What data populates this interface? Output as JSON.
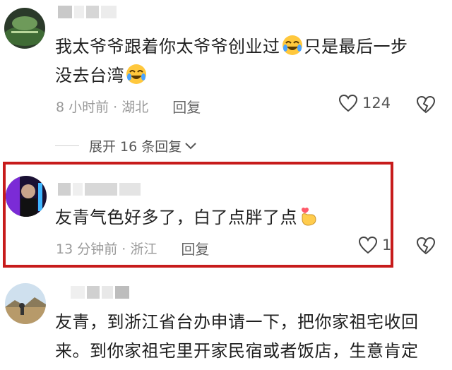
{
  "comments": [
    {
      "text_line1": "我太爷爷跟着你太爷爷创业过",
      "text_line1_after": "只是最后一步",
      "text_line2": "没去台湾",
      "time": "8 小时前 · 湖北",
      "reply_label": "回复",
      "likes": "124"
    },
    {
      "text": "友青气色好多了，白了点胖了点",
      "time": "13 分钟前 · 浙江",
      "reply_label": "回复",
      "likes": "1"
    },
    {
      "text_line1": "友青，到浙江省台办申请一下，把你家祖宅收回",
      "text_line2": "来。到你家祖宅里开家民宿或者饭店，生意肯定"
    }
  ],
  "expand_replies": "展开 16 条回复",
  "colors": {
    "highlight": "#c71b1b",
    "meta": "#9a9a9a"
  },
  "icons": [
    "laughing-emoji-icon",
    "heart-icon",
    "broken-heart-icon",
    "chevron-down-icon",
    "hand-heart-emoji-icon"
  ]
}
